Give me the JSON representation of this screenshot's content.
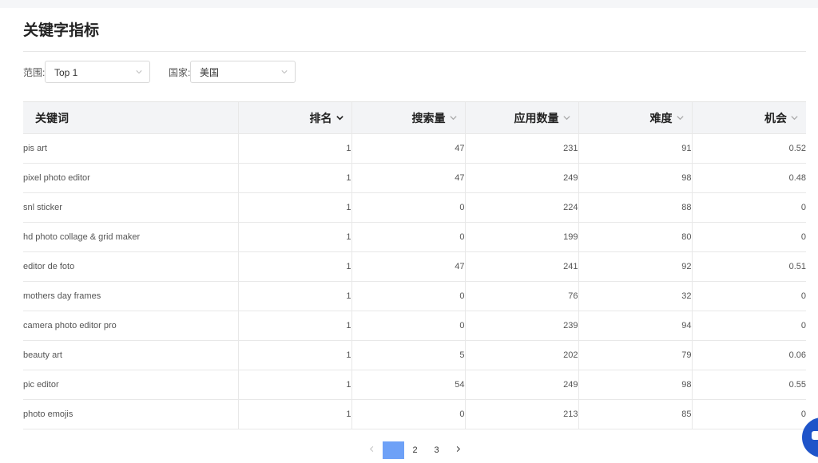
{
  "page_title": "关键字指标",
  "filters": {
    "range_label": "范围:",
    "range_value": "Top 1",
    "country_label": "国家:",
    "country_value": "美国"
  },
  "table": {
    "columns": [
      "关键词",
      "排名",
      "搜索量",
      "应用数量",
      "难度",
      "机会"
    ],
    "rows": [
      {
        "keyword": "pis art",
        "rank": "1",
        "search_volume": "47",
        "app_count": "231",
        "difficulty": "91",
        "opportunity": "0.52"
      },
      {
        "keyword": "pixel photo editor",
        "rank": "1",
        "search_volume": "47",
        "app_count": "249",
        "difficulty": "98",
        "opportunity": "0.48"
      },
      {
        "keyword": "snl sticker",
        "rank": "1",
        "search_volume": "0",
        "app_count": "224",
        "difficulty": "88",
        "opportunity": "0"
      },
      {
        "keyword": "hd photo collage & grid maker",
        "rank": "1",
        "search_volume": "0",
        "app_count": "199",
        "difficulty": "80",
        "opportunity": "0"
      },
      {
        "keyword": "editor de foto",
        "rank": "1",
        "search_volume": "47",
        "app_count": "241",
        "difficulty": "92",
        "opportunity": "0.51"
      },
      {
        "keyword": "mothers day frames",
        "rank": "1",
        "search_volume": "0",
        "app_count": "76",
        "difficulty": "32",
        "opportunity": "0"
      },
      {
        "keyword": "camera photo editor pro",
        "rank": "1",
        "search_volume": "0",
        "app_count": "239",
        "difficulty": "94",
        "opportunity": "0"
      },
      {
        "keyword": "beauty art",
        "rank": "1",
        "search_volume": "5",
        "app_count": "202",
        "difficulty": "79",
        "opportunity": "0.06"
      },
      {
        "keyword": "pic editor",
        "rank": "1",
        "search_volume": "54",
        "app_count": "249",
        "difficulty": "98",
        "opportunity": "0.55"
      },
      {
        "keyword": "photo emojis",
        "rank": "1",
        "search_volume": "0",
        "app_count": "213",
        "difficulty": "85",
        "opportunity": "0"
      }
    ]
  },
  "pagination": {
    "pages": [
      "1",
      "2",
      "3"
    ],
    "current": "1"
  },
  "colors": {
    "accent": "#6ea1f7",
    "fab": "#1f54c9",
    "header_bg": "#f3f4f6"
  }
}
